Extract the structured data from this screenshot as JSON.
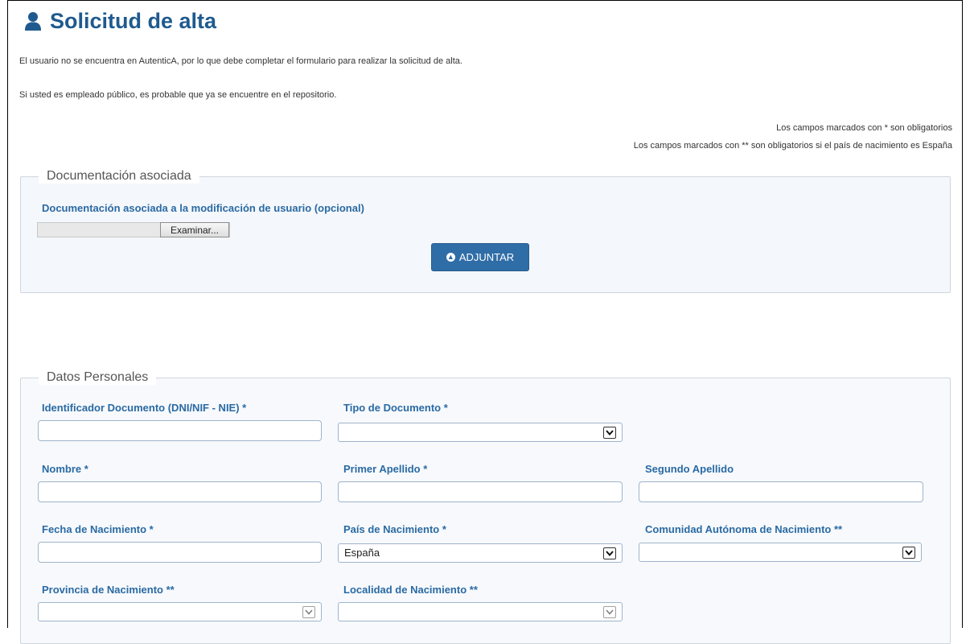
{
  "page": {
    "title": "Solicitud de alta",
    "intro1": "El usuario no se encuentra en AutenticA, por lo que debe completar el formulario para realizar la solicitud de alta.",
    "intro2": "Si usted es empleado público, es probable que ya se encuentre en el repositorio.",
    "required_note1": "Los campos marcados con * son obligatorios",
    "required_note2": "Los campos marcados con ** son obligatorios si el país de nacimiento es España"
  },
  "documentacion": {
    "legend": "Documentación asociada",
    "label": "Documentación asociada a la modificación de usuario (opcional)",
    "browse_label": "Examinar...",
    "attach_label": "ADJUNTAR"
  },
  "datos": {
    "legend": "Datos Personales",
    "fields": {
      "identificador": {
        "label": "Identificador Documento (DNI/NIF - NIE) *",
        "value": ""
      },
      "tipo_documento": {
        "label": "Tipo de Documento *",
        "value": ""
      },
      "nombre": {
        "label": "Nombre *",
        "value": ""
      },
      "primer_apellido": {
        "label": "Primer Apellido *",
        "value": ""
      },
      "segundo_apellido": {
        "label": "Segundo Apellido",
        "value": ""
      },
      "fecha_nacimiento": {
        "label": "Fecha de Nacimiento *",
        "value": ""
      },
      "pais_nacimiento": {
        "label": "País de Nacimiento *",
        "value": "España"
      },
      "comunidad_autonoma": {
        "label": "Comunidad Autónoma de Nacimiento **",
        "value": ""
      },
      "provincia": {
        "label": "Provincia de Nacimiento **",
        "value": ""
      },
      "localidad": {
        "label": "Localidad de Nacimiento **",
        "value": ""
      }
    }
  },
  "icons": {
    "title_icon": "user-icon",
    "attach_icon": "circle-arrow-up-icon",
    "dropdown_icon": "chevron-down-icon"
  },
  "colors": {
    "heading": "#1f5a8f",
    "label": "#2a6aa3",
    "button": "#2f6da7",
    "panel": "#f4f7fb"
  }
}
